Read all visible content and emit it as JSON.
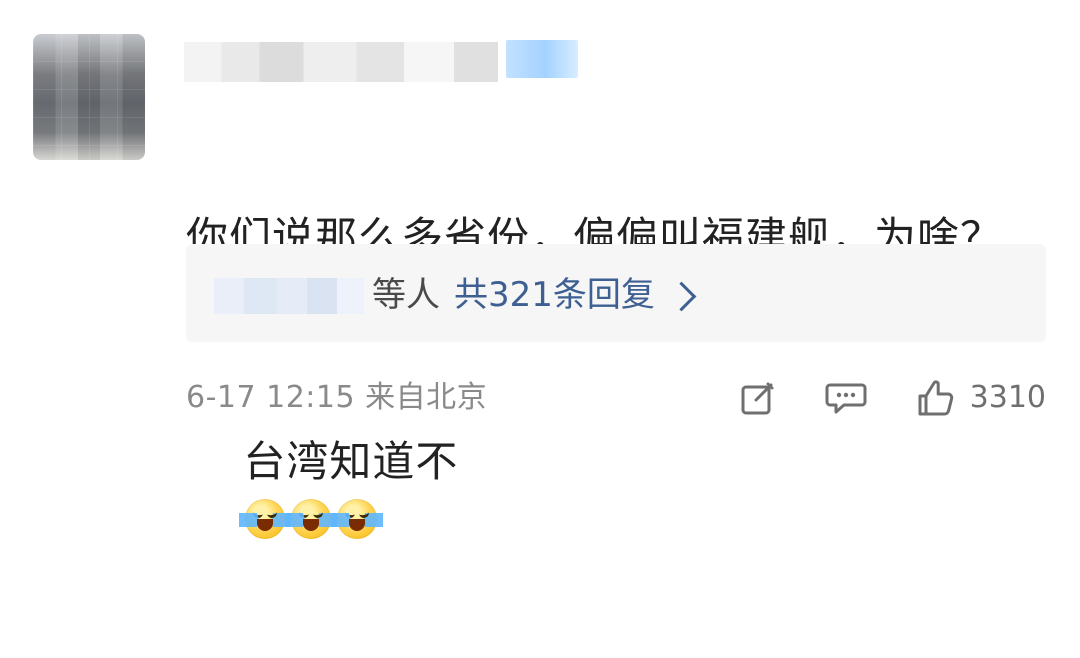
{
  "comment": {
    "line1": "你们说那么多省份，偏偏叫福建舰，为啥？",
    "line2": "台湾知道不"
  },
  "replies": {
    "prefix": "等人",
    "link": "共321条回复"
  },
  "footer": {
    "meta": "6-17 12:15 来自北京",
    "like_count": "3310"
  },
  "icons": {
    "edit": "edit-icon",
    "comment": "comment-icon",
    "like": "thumbs-up-icon",
    "chevron": "chevron-right-icon",
    "emoji": "laughing-tears-emoji"
  },
  "colors": {
    "text_main": "#222222",
    "text_meta": "#8a8a8a",
    "link_blue": "#3e5f92",
    "reply_bg": "#f6f6f6"
  }
}
